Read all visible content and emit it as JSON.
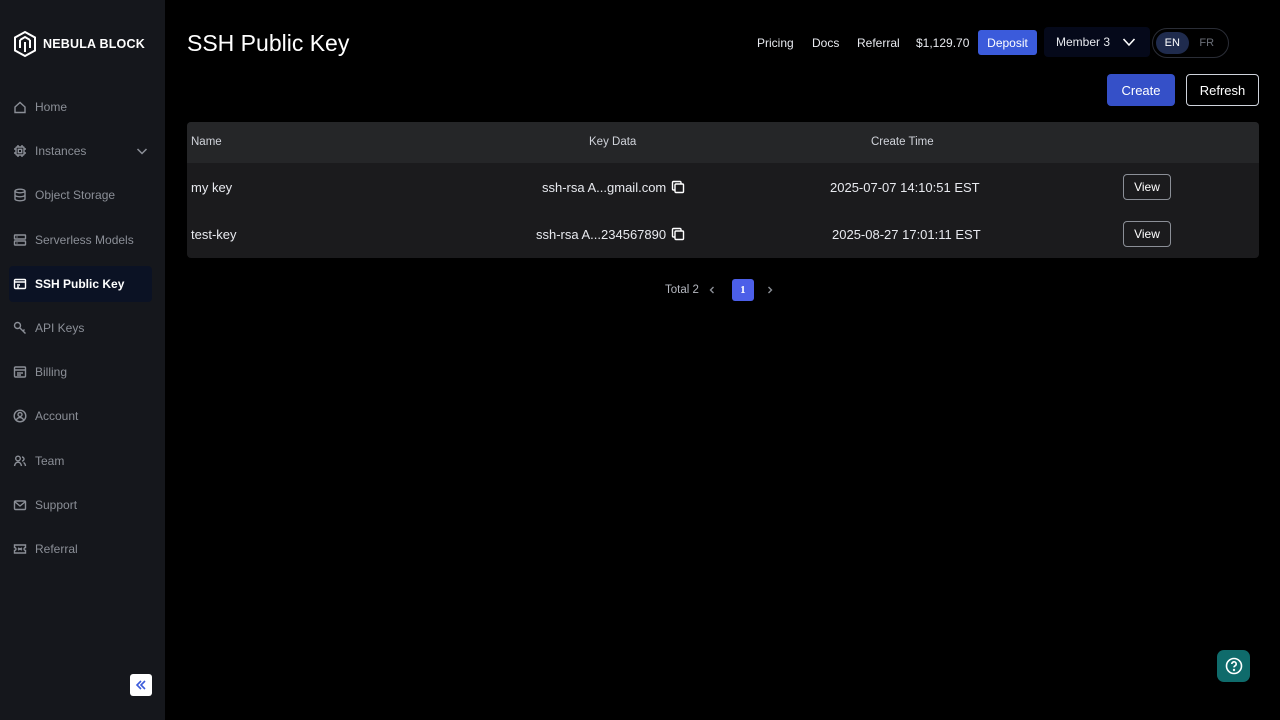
{
  "brand": {
    "name": "NEBULA BLOCK"
  },
  "sidebar": {
    "items": [
      {
        "label": "Home",
        "icon": "home-icon"
      },
      {
        "label": "Instances",
        "icon": "chip-icon",
        "expandable": true
      },
      {
        "label": "Object Storage",
        "icon": "database-icon"
      },
      {
        "label": "Serverless Models",
        "icon": "server-icon"
      },
      {
        "label": "SSH Public Key",
        "icon": "key-card-icon",
        "active": true
      },
      {
        "label": "API Keys",
        "icon": "key-icon"
      },
      {
        "label": "Billing",
        "icon": "billing-icon"
      },
      {
        "label": "Account",
        "icon": "account-icon"
      },
      {
        "label": "Team",
        "icon": "team-icon"
      },
      {
        "label": "Support",
        "icon": "mail-icon"
      },
      {
        "label": "Referral",
        "icon": "ticket-icon"
      }
    ]
  },
  "header": {
    "title": "SSH Public Key",
    "links": {
      "pricing": "Pricing",
      "docs": "Docs",
      "referral": "Referral"
    },
    "balance": "$1,129.70",
    "deposit": "Deposit",
    "member": "Member 3",
    "languages": {
      "en": "EN",
      "fr": "FR",
      "selected": "EN"
    }
  },
  "actions": {
    "create": "Create",
    "refresh": "Refresh"
  },
  "table": {
    "columns": {
      "name": "Name",
      "key_data": "Key Data",
      "create_time": "Create Time"
    },
    "rows": [
      {
        "name": "my key",
        "key_data": "ssh-rsa A...gmail.com",
        "create_time": "2025-07-07 14:10:51 EST",
        "action": "View"
      },
      {
        "name": "test-key",
        "key_data": "ssh-rsa A...234567890",
        "create_time": "2025-08-27 17:01:11 EST",
        "action": "View"
      }
    ]
  },
  "pagination": {
    "total": "Total 2",
    "current_page": "1"
  },
  "colors": {
    "accent": "#3b5bdb",
    "sidebar_bg": "#15171c",
    "help_bg": "#0f6b6b"
  }
}
